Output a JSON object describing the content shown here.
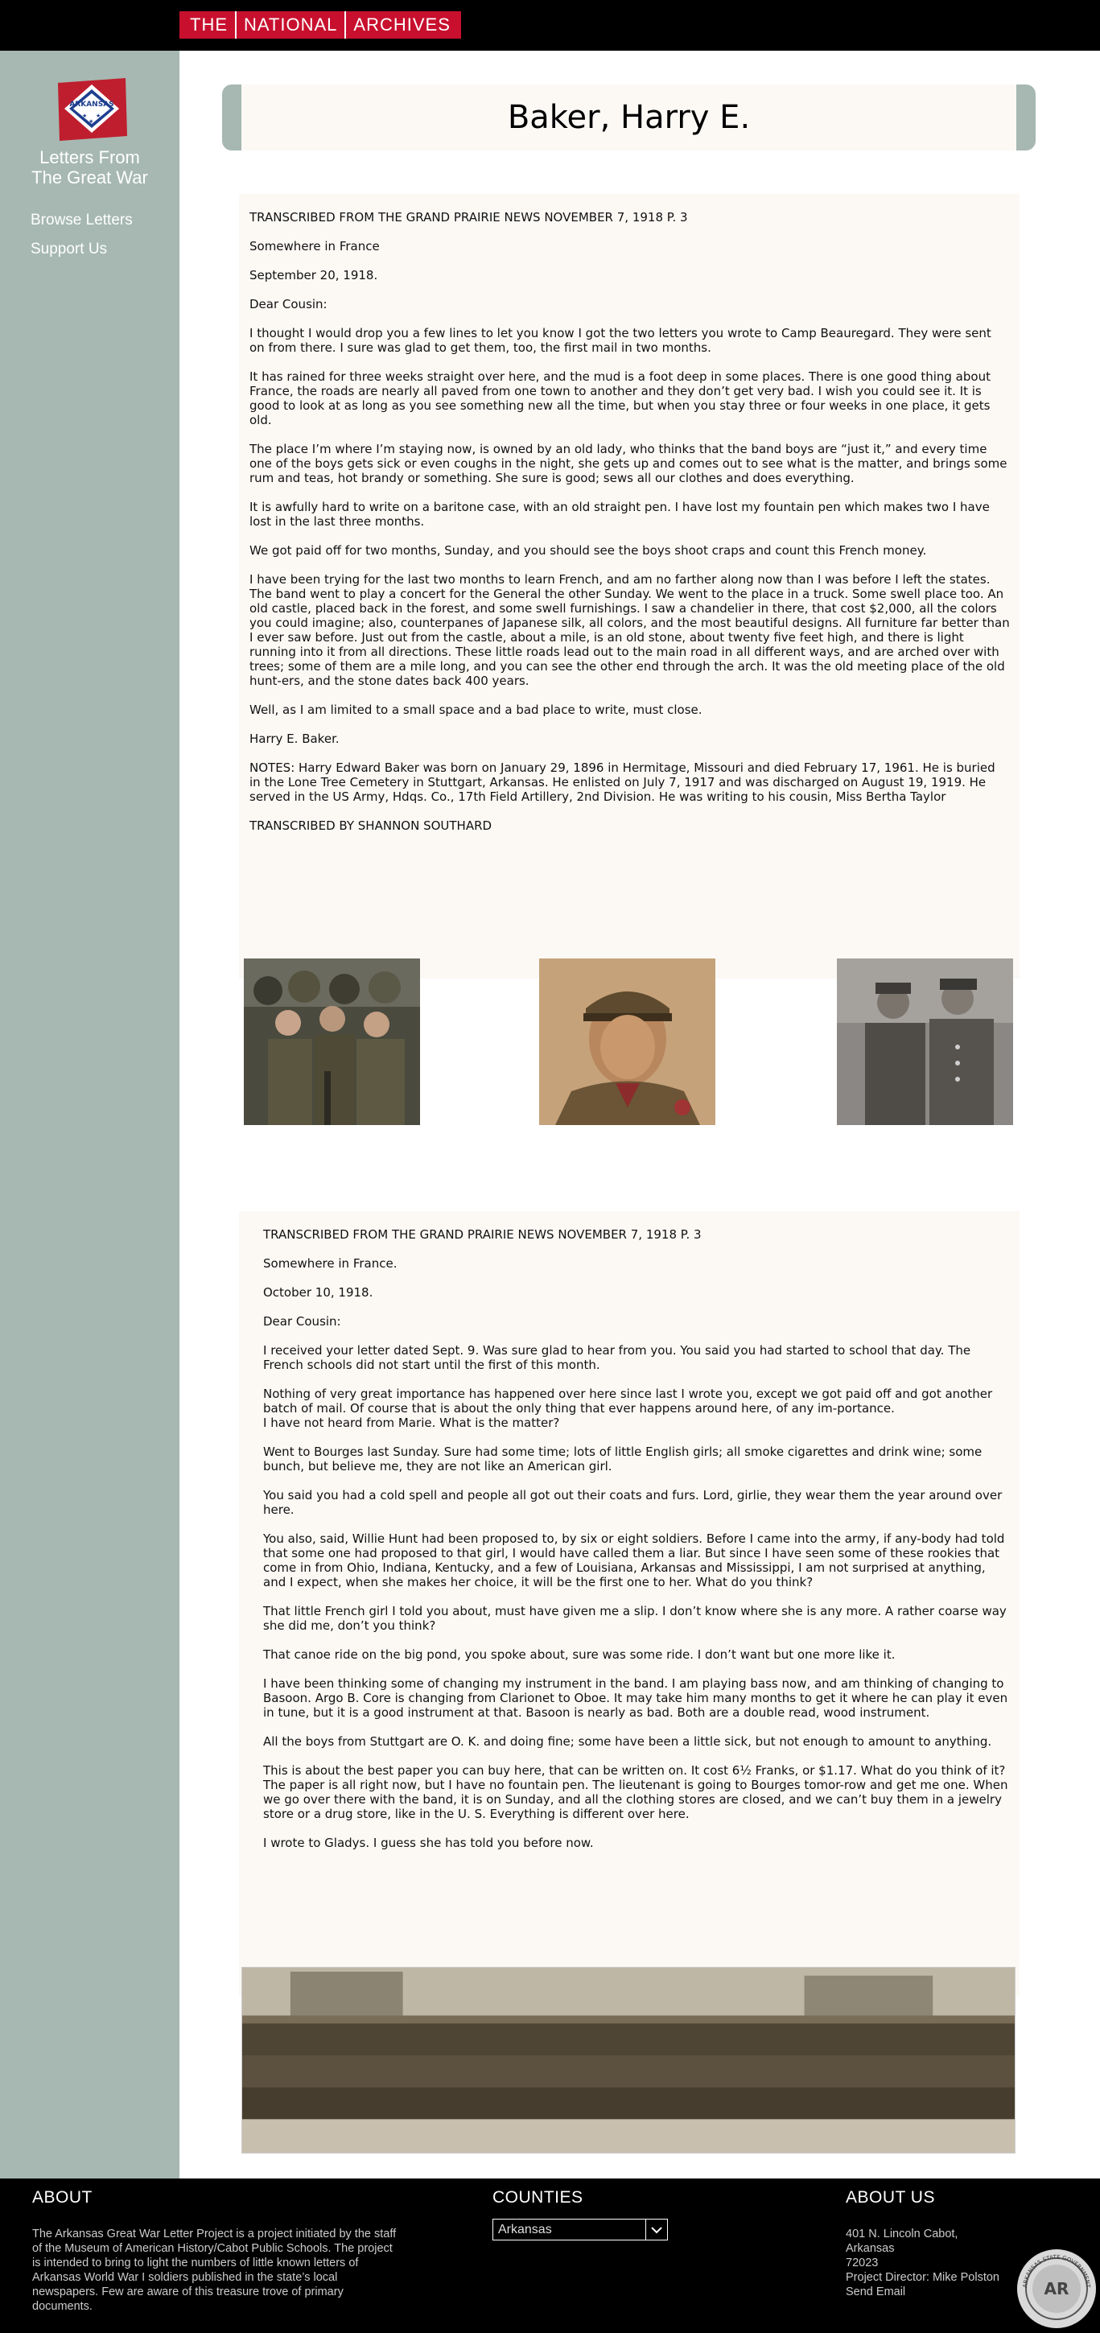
{
  "header": {
    "logo_words": [
      "THE",
      "NATIONAL",
      "ARCHIVES"
    ]
  },
  "sidebar": {
    "flag_text": "ARKANSAS",
    "site_title_line1": "Letters From",
    "site_title_line2": "The Great War",
    "nav": [
      {
        "label": "Browse Letters"
      },
      {
        "label": "Support Us"
      }
    ]
  },
  "page": {
    "title": "Baker, Harry E."
  },
  "letter1": {
    "paragraphs": [
      "TRANSCRIBED FROM THE GRAND PRAIRIE NEWS NOVEMBER 7, 1918 P. 3",
      "Somewhere in France",
      "September 20, 1918.",
      "Dear Cousin:",
      "I thought I would drop you a few lines to let you know I got the two letters you wrote to Camp Beauregard. They were sent on from there. I sure was glad to get them, too, the first mail in two months.",
      "It has rained for three weeks straight over here, and the mud is a foot deep in some places. There is one good thing about France, the roads are nearly all paved from one town to another and they don’t get very bad. I wish you could see it. It is good to look at as long as you see something new all the time, but when you stay three or four weeks in one place, it gets old.",
      "The place I’m where I’m staying now, is owned by an old lady, who thinks that the band boys are “just it,” and every time one of the boys gets sick or even coughs in the night, she gets up and comes out to see what is the matter, and brings some rum and teas, hot brandy or something. She sure is good; sews all our clothes and does everything.",
      "It is awfully hard to write on a baritone case, with an old straight pen. I have lost my fountain pen which makes two I have lost in the last three months.",
      "We got paid off for two months, Sunday, and you should see the boys shoot craps and count this French money.",
      "I have been trying for the last two months to learn French, and am no farther along now than I was before I left the states.",
      "The band went to play a concert for the General the other Sunday. We went to the place in a truck. Some swell place too. An old castle, placed back in the forest, and some swell furnishings. I saw a chandelier in there, that cost $2,000, all the colors you could imagine; also, counterpanes of Japanese silk, all colors, and the most beautiful designs. All furniture far better than I ever saw before. Just out from the castle, about a mile, is an old stone, about twenty five feet high, and there is light running into it from all directions. These little roads lead out to the main road in all different ways, and are arched over with trees; some of them are a mile long, and you can see the other end through the arch. It was the old meeting place of the old hunt-ers, and the stone dates back 400 years.",
      "Well, as I am limited to a small space and a bad place to write, must close.",
      "Harry E. Baker.",
      "NOTES: Harry Edward Baker was born on January 29, 1896 in Hermitage, Missouri and died February 17, 1961. He is buried in the Lone Tree Cemetery in Stuttgart, Arkansas. He enlisted on July 7, 1917 and was discharged on August 19, 1919. He served in the US Army, Hdqs. Co., 17th Field Artillery, 2nd Division. He was writing to his cousin, Miss Bertha Taylor",
      "TRANSCRIBED BY SHANNON SOUTHARD"
    ]
  },
  "letter2": {
    "paragraphs": [
      "TRANSCRIBED FROM THE GRAND PRAIRIE NEWS NOVEMBER 7, 1918 P. 3",
      "Somewhere in France.",
      "October 10, 1918.",
      "Dear Cousin:",
      "I received your letter dated Sept. 9. Was sure glad to hear from you. You said you had started to school that day. The French schools did not start until the first of this month.",
      "Nothing of very great importance has happened over here since last I wrote you, except we got paid off and got another batch of mail. Of course that is about the only thing that ever happens around here, of any im-portance.",
      "I have not heard from Marie. What is the matter?",
      "Went to Bourges last Sunday. Sure had some time; lots of little English girls; all smoke cigarettes and drink wine; some bunch, but believe me, they are not like an American girl.",
      "You said you had a cold spell and people all got out their coats and furs. Lord, girlie, they wear them the year around over here.",
      "You also, said, Willie Hunt had been proposed to, by six or eight soldiers. Before I came into the army, if any-body had told that some one had proposed to that girl, I would have called them a liar. But since I have seen some of these rookies that come in from Ohio, Indiana, Kentucky, and a few of Louisiana, Arkansas and Mississippi, I am not surprised at anything, and I expect, when she makes her choice, it will be the first one to her. What do you think?",
      "That little French girl I told you about, must have given me a slip. I don’t know where she is any more. A rather coarse way she did me, don’t you think?",
      "That canoe ride on the big pond, you spoke about, sure was some ride. I don’t want but one more like it.",
      "I have been thinking some of changing my instrument in the band. I am playing bass now, and am thinking of changing to Basoon. Argo B. Core is changing from Clarionet to Oboe. It may take him many months to get it where he can play it even in tune, but it is a good instrument at that. Basoon is nearly as bad. Both are a double read, wood instrument.",
      "All the boys from Stuttgart are O. K. and doing fine; some have been a little sick, but not enough to amount to anything.",
      "This is about the best paper you can buy here, that can be written on. It cost 6½ Franks, or $1.17. What do you think of it? The paper is all right now, but I have no fountain pen. The lieutenant is going to Bourges tomor-row and get me one. When we go over there with the band, it is on Sunday, and all the clothing stores are closed, and we can’t buy them in a jewelry store or a drug store, like in the U. S. Everything is different over here.",
      "I wrote to Gladys. I guess she has told you before now."
    ]
  },
  "footer": {
    "about_heading": "ABOUT",
    "about_text": "The Arkansas Great War Letter Project  is a project initiated by the staff of the Museum of American History/Cabot Public Schools. The project is intended to bring to light the numbers of little known letters of Arkansas World War I soldiers published in the state’s local newspapers. Few are aware of this treasure trove of primary documents.",
    "counties_heading": "COUNTIES",
    "county_selected": "Arkansas",
    "about_us_heading": "ABOUT US",
    "address_line1": "401 N. Lincoln Cabot, Arkansas",
    "address_line2": "72023",
    "director": "Project Director: Mike Polston",
    "send_email": "Send Email",
    "seal_text": "ARKANSAS STATE GOVERNMENT"
  },
  "colors": {
    "sidebar": "#a6b8b1",
    "paper": "#fcf9f5",
    "archives_red": "#c8102e",
    "black": "#000000"
  }
}
